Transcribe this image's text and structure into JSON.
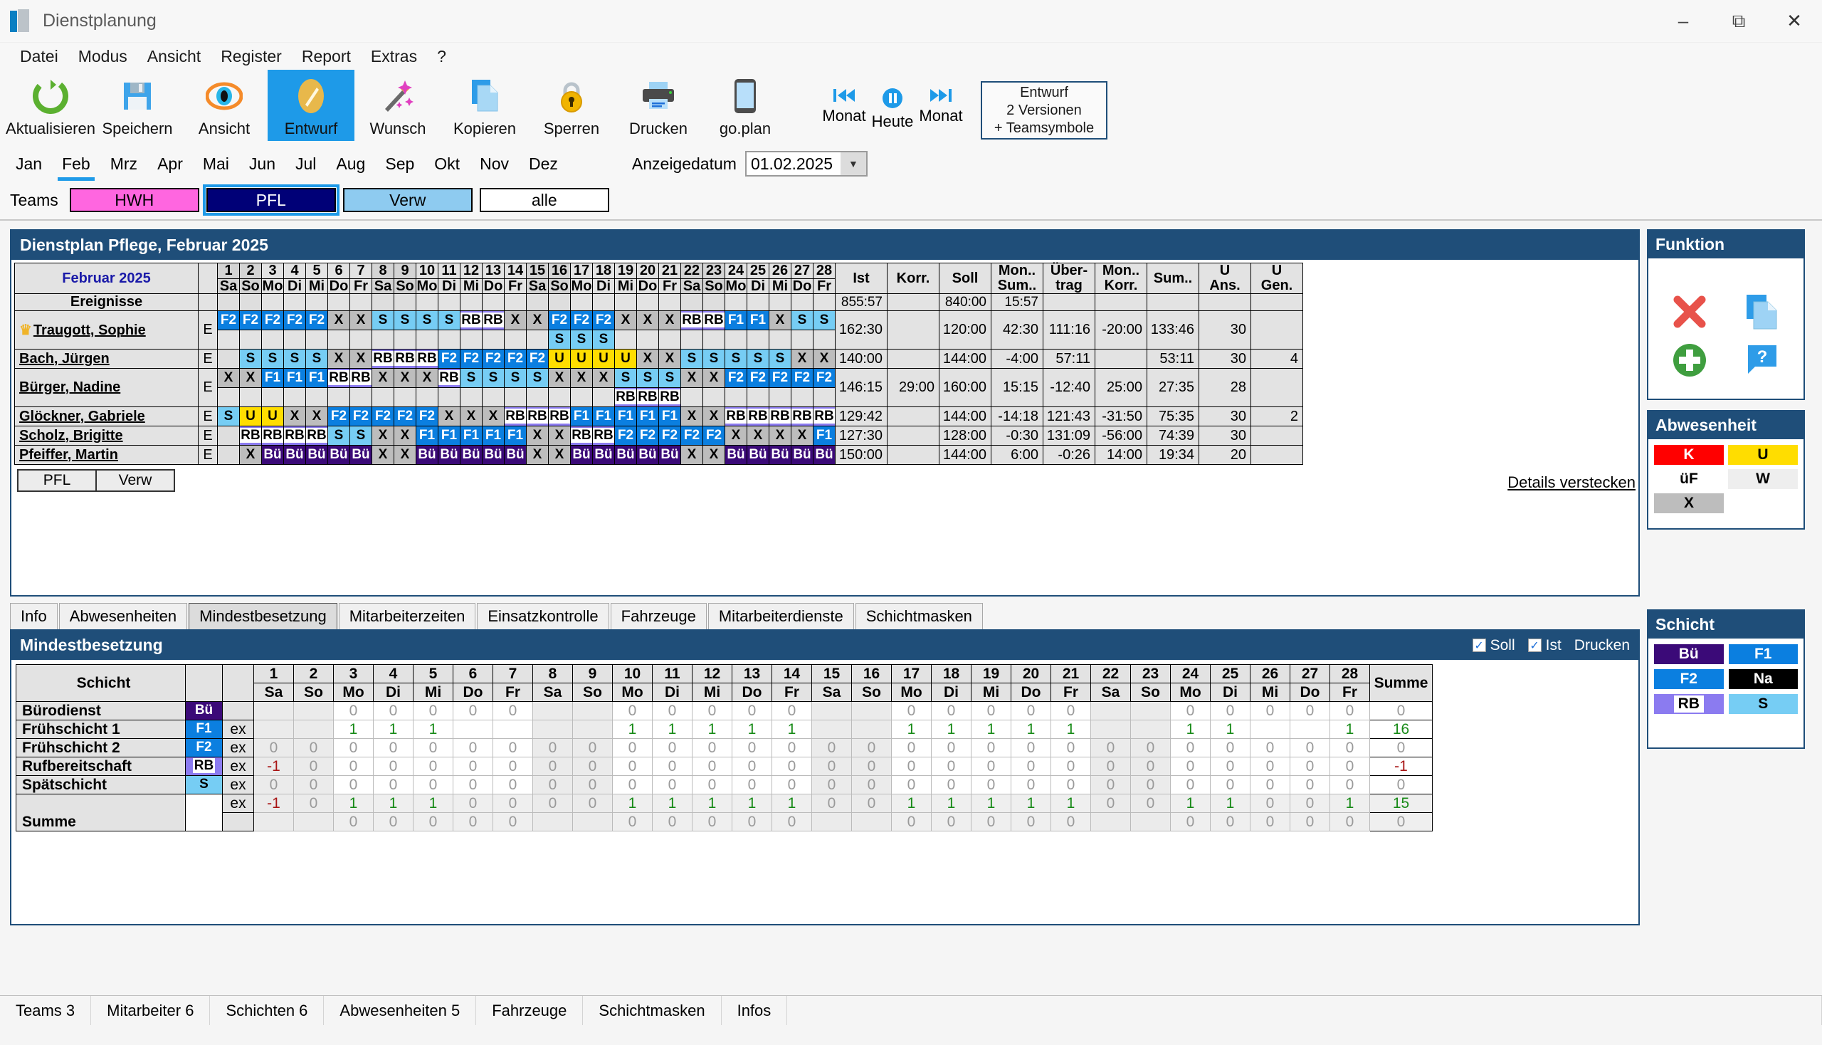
{
  "window": {
    "title": "Dienstplanung",
    "app_icon": "book-icon",
    "minimize": "minimize-icon",
    "restore": "restore-icon",
    "close": "close-icon"
  },
  "menu": {
    "items": [
      "Datei",
      "Modus",
      "Ansicht",
      "Register",
      "Report",
      "Extras",
      "?"
    ]
  },
  "toolbar": {
    "buttons": [
      {
        "label": "Aktualisieren",
        "icon": "refresh-icon",
        "selected": false
      },
      {
        "label": "Speichern",
        "icon": "floppy-disk-icon",
        "selected": false
      },
      {
        "label": "Ansicht",
        "icon": "eye-icon",
        "selected": false
      },
      {
        "label": "Entwurf",
        "icon": "pencil-icon",
        "selected": true
      },
      {
        "label": "Wunsch",
        "icon": "magic-wand-icon",
        "selected": false
      },
      {
        "label": "Kopieren",
        "icon": "copy-icon",
        "selected": false
      },
      {
        "label": "Sperren",
        "icon": "padlock-icon",
        "selected": false
      },
      {
        "label": "Drucken",
        "icon": "printer-icon",
        "selected": false
      },
      {
        "label": "go.plan",
        "icon": "smartphone-icon",
        "selected": false
      }
    ],
    "nav": [
      {
        "label": "Monat",
        "icon": "skip-back-icon"
      },
      {
        "label": "Heute",
        "icon": "pause-circle-icon"
      },
      {
        "label": "Monat",
        "icon": "skip-forward-icon"
      }
    ],
    "version_box": [
      "Entwurf",
      "2 Versionen",
      "+ Teamsymbole"
    ]
  },
  "months": {
    "items": [
      "Jan",
      "Feb",
      "Mrz",
      "Apr",
      "Mai",
      "Jun",
      "Jul",
      "Aug",
      "Sep",
      "Okt",
      "Nov",
      "Dez"
    ],
    "active": "Feb",
    "date_label": "Anzeigedatum",
    "date_value": "01.02.2025"
  },
  "teams": {
    "label": "Teams",
    "items": [
      {
        "name": "HWH",
        "bg": "#ff66e0",
        "fg": "#000000",
        "selected": false
      },
      {
        "name": "PFL",
        "bg": "#000077",
        "fg": "#ffffff",
        "selected": true
      },
      {
        "name": "Verw",
        "bg": "#8ecbf0",
        "fg": "#000000",
        "selected": false
      },
      {
        "name": "alle",
        "bg": "#ffffff",
        "fg": "#000000",
        "selected": false
      }
    ]
  },
  "schedule": {
    "title": "Dienstplan Pflege,  Februar 2025",
    "month_title": "Februar 2025",
    "events_label": "Ereignisse",
    "days": [
      {
        "n": "1",
        "w": "Sa",
        "we": true
      },
      {
        "n": "2",
        "w": "So",
        "we": true
      },
      {
        "n": "3",
        "w": "Mo",
        "we": false
      },
      {
        "n": "4",
        "w": "Di",
        "we": false
      },
      {
        "n": "5",
        "w": "Mi",
        "we": false
      },
      {
        "n": "6",
        "w": "Do",
        "we": false
      },
      {
        "n": "7",
        "w": "Fr",
        "we": false
      },
      {
        "n": "8",
        "w": "Sa",
        "we": true
      },
      {
        "n": "9",
        "w": "So",
        "we": true
      },
      {
        "n": "10",
        "w": "Mo",
        "we": false
      },
      {
        "n": "11",
        "w": "Di",
        "we": false
      },
      {
        "n": "12",
        "w": "Mi",
        "we": false
      },
      {
        "n": "13",
        "w": "Do",
        "we": false
      },
      {
        "n": "14",
        "w": "Fr",
        "we": false
      },
      {
        "n": "15",
        "w": "Sa",
        "we": true
      },
      {
        "n": "16",
        "w": "So",
        "we": true
      },
      {
        "n": "17",
        "w": "Mo",
        "we": false
      },
      {
        "n": "18",
        "w": "Di",
        "we": false
      },
      {
        "n": "19",
        "w": "Mi",
        "we": false
      },
      {
        "n": "20",
        "w": "Do",
        "we": false
      },
      {
        "n": "21",
        "w": "Fr",
        "we": false
      },
      {
        "n": "22",
        "w": "Sa",
        "we": true
      },
      {
        "n": "23",
        "w": "So",
        "we": true
      },
      {
        "n": "24",
        "w": "Mo",
        "we": false
      },
      {
        "n": "25",
        "w": "Di",
        "we": false
      },
      {
        "n": "26",
        "w": "Mi",
        "we": false
      },
      {
        "n": "27",
        "w": "Do",
        "we": false
      },
      {
        "n": "28",
        "w": "Fr",
        "we": false
      }
    ],
    "num_headers": [
      "Ist",
      "Korr.",
      "Soll",
      "Mon..\nSum..",
      "Über-\ntrag",
      "Mon..\nKorr.",
      "Sum..",
      "U\nAns.",
      "U\nGen."
    ],
    "totals_row": {
      "ist": "855:57",
      "korr": "",
      "soll": "840:00",
      "monsum": "15:57",
      "uebertrag": "",
      "monkorr": "",
      "sum": "",
      "uans": "",
      "ugen": ""
    },
    "employees": [
      {
        "name": "Traugott, Sophie",
        "crown": true,
        "E": "E",
        "shifts1": [
          "F2",
          "F2",
          "F2",
          "F2",
          "F2",
          "X",
          "X",
          "S",
          "S",
          "S",
          "S",
          "RB",
          "RB",
          "X",
          "X",
          "F2",
          "F2",
          "F2",
          "X",
          "X",
          "X",
          "RB",
          "RB",
          "F1",
          "F1",
          "X",
          "S",
          "S"
        ],
        "shifts2": [
          "",
          "",
          "",
          "",
          "",
          "",
          "",
          "",
          "",
          "",
          "",
          "",
          "",
          "",
          "",
          "S",
          "S",
          "S",
          "",
          "",
          "",
          "",
          "",
          "",
          "",
          "",
          "",
          ""
        ],
        "ist": "162:30",
        "korr": "",
        "soll": "120:00",
        "monsum": "42:30",
        "uebertrag": "111:16",
        "monkorr": "-20:00",
        "sum": "133:46",
        "uans": "30",
        "ugen": ""
      },
      {
        "name": "Bach, Jürgen",
        "crown": false,
        "E": "E",
        "shifts1": [
          "",
          "S",
          "S",
          "S",
          "S",
          "X",
          "X",
          "RB",
          "RB",
          "RB",
          "F2",
          "F2",
          "F2",
          "F2",
          "F2",
          "U",
          "U",
          "U",
          "U",
          "X",
          "X",
          "S",
          "S",
          "S",
          "S",
          "S",
          "X",
          "X"
        ],
        "shifts2": [],
        "ist": "140:00",
        "korr": "",
        "soll": "144:00",
        "monsum": "-4:00",
        "uebertrag": "57:11",
        "monkorr": "",
        "sum": "53:11",
        "uans": "30",
        "ugen": "4"
      },
      {
        "name": "Bürger, Nadine",
        "crown": false,
        "E": "E",
        "shifts1": [
          "X",
          "X",
          "F1",
          "F1",
          "F1",
          "RB",
          "RB",
          "X",
          "X",
          "X",
          "RB",
          "S",
          "S",
          "S",
          "S",
          "X",
          "X",
          "X",
          "S",
          "S",
          "S",
          "X",
          "X",
          "F2",
          "F2",
          "F2",
          "F2",
          "F2"
        ],
        "shifts2": [
          "",
          "",
          "",
          "",
          "",
          "",
          "",
          "",
          "",
          "",
          "",
          "",
          "",
          "",
          "",
          "",
          "",
          "",
          "RB",
          "RB",
          "RB",
          "",
          "",
          "",
          "",
          "",
          "",
          ""
        ],
        "ist": "146:15",
        "korr": "29:00",
        "soll": "160:00",
        "monsum": "15:15",
        "uebertrag": "-12:40",
        "monkorr": "25:00",
        "sum": "27:35",
        "uans": "28",
        "ugen": ""
      },
      {
        "name": "Glöckner, Gabriele",
        "crown": false,
        "E": "E",
        "shifts1": [
          "S",
          "U",
          "U",
          "X",
          "X",
          "F2",
          "F2",
          "F2",
          "F2",
          "F2",
          "X",
          "X",
          "X",
          "RB",
          "RB",
          "RB",
          "F1",
          "F1",
          "F1",
          "F1",
          "F1",
          "X",
          "X",
          "RB",
          "RB",
          "RB",
          "RB",
          "RB"
        ],
        "shifts2": [],
        "ist": "129:42",
        "korr": "",
        "soll": "144:00",
        "monsum": "-14:18",
        "uebertrag": "121:43",
        "monkorr": "-31:50",
        "sum": "75:35",
        "uans": "30",
        "ugen": "2"
      },
      {
        "name": "Scholz, Brigitte",
        "crown": false,
        "E": "E",
        "shifts1": [
          "",
          "RB",
          "RB",
          "RB",
          "RB",
          "S",
          "S",
          "X",
          "X",
          "F1",
          "F1",
          "F1",
          "F1",
          "F1",
          "X",
          "X",
          "RB",
          "RB",
          "F2",
          "F2",
          "F2",
          "F2",
          "F2",
          "X",
          "X",
          "X",
          "X",
          "F1"
        ],
        "shifts2": [],
        "ist": "127:30",
        "korr": "",
        "soll": "128:00",
        "monsum": "-0:30",
        "uebertrag": "131:09",
        "monkorr": "-56:00",
        "sum": "74:39",
        "uans": "30",
        "ugen": ""
      },
      {
        "name": "Pfeiffer, Martin",
        "crown": false,
        "E": "E",
        "shifts1": [
          "",
          "X",
          "Bü",
          "Bü",
          "Bü",
          "Bü",
          "Bü",
          "X",
          "X",
          "Bü",
          "Bü",
          "Bü",
          "Bü",
          "Bü",
          "X",
          "X",
          "Bü",
          "Bü",
          "Bü",
          "Bü",
          "Bü",
          "X",
          "X",
          "Bü",
          "Bü",
          "Bü",
          "Bü",
          "Bü"
        ],
        "shifts2": [],
        "ist": "150:00",
        "korr": "",
        "soll": "144:00",
        "monsum": "6:00",
        "uebertrag": "-0:26",
        "monkorr": "14:00",
        "sum": "19:34",
        "uans": "20",
        "ugen": ""
      }
    ],
    "footer_team_buttons": [
      "PFL",
      "Verw"
    ],
    "details_link": "Details verstecken"
  },
  "tabs": {
    "items": [
      "Info",
      "Abwesenheiten",
      "Mindestbesetzung",
      "Mitarbeiterzeiten",
      "Einsatzkontrolle",
      "Fahrzeuge",
      "Mitarbeiterdienste",
      "Schichtmasken"
    ],
    "active": "Mindestbesetzung"
  },
  "mindestbesetzung": {
    "title": "Mindestbesetzung",
    "soll_label": "Soll",
    "ist_label": "Ist",
    "drucken_label": "Drucken",
    "col_schicht": "Schicht",
    "col_summe": "Summe",
    "days": [
      {
        "n": "1",
        "w": "Sa",
        "we": true
      },
      {
        "n": "2",
        "w": "So",
        "we": true
      },
      {
        "n": "3",
        "w": "Mo",
        "we": false
      },
      {
        "n": "4",
        "w": "Di",
        "we": false
      },
      {
        "n": "5",
        "w": "Mi",
        "we": false
      },
      {
        "n": "6",
        "w": "Do",
        "we": false
      },
      {
        "n": "7",
        "w": "Fr",
        "we": false
      },
      {
        "n": "8",
        "w": "Sa",
        "we": true
      },
      {
        "n": "9",
        "w": "So",
        "we": true
      },
      {
        "n": "10",
        "w": "Mo",
        "we": false
      },
      {
        "n": "11",
        "w": "Di",
        "we": false
      },
      {
        "n": "12",
        "w": "Mi",
        "we": false
      },
      {
        "n": "13",
        "w": "Do",
        "we": false
      },
      {
        "n": "14",
        "w": "Fr",
        "we": false
      },
      {
        "n": "15",
        "w": "Sa",
        "we": true
      },
      {
        "n": "16",
        "w": "So",
        "we": true
      },
      {
        "n": "17",
        "w": "Mo",
        "we": false
      },
      {
        "n": "18",
        "w": "Di",
        "we": false
      },
      {
        "n": "19",
        "w": "Mi",
        "we": false
      },
      {
        "n": "20",
        "w": "Do",
        "we": false
      },
      {
        "n": "21",
        "w": "Fr",
        "we": false
      },
      {
        "n": "22",
        "w": "Sa",
        "we": true
      },
      {
        "n": "23",
        "w": "So",
        "we": true
      },
      {
        "n": "24",
        "w": "Mo",
        "we": false
      },
      {
        "n": "25",
        "w": "Di",
        "we": false
      },
      {
        "n": "26",
        "w": "Mi",
        "we": false
      },
      {
        "n": "27",
        "w": "Do",
        "we": false
      },
      {
        "n": "28",
        "w": "Fr",
        "we": false
      }
    ],
    "rows": [
      {
        "name": "Bürodienst",
        "code": "Bü",
        "code_style": "s-Bu",
        "ex": "",
        "values": [
          "",
          "",
          "0",
          "0",
          "0",
          "0",
          "0",
          "",
          "",
          "0",
          "0",
          "0",
          "0",
          "0",
          "",
          "",
          "0",
          "0",
          "0",
          "0",
          "0",
          "",
          "",
          "0",
          "0",
          "0",
          "0",
          "0"
        ],
        "summe": "0"
      },
      {
        "name": "Frühschicht 1",
        "code": "F1",
        "code_style": "s-F1",
        "ex": "ex",
        "values": [
          "",
          "",
          "1",
          "1",
          "1",
          "",
          "",
          "",
          "",
          "1",
          "1",
          "1",
          "1",
          "1",
          "",
          "",
          "1",
          "1",
          "1",
          "1",
          "1",
          "",
          "",
          "1",
          "1",
          "",
          "",
          "1"
        ],
        "summe": "16"
      },
      {
        "name": "Frühschicht 2",
        "code": "F2",
        "code_style": "s-F2",
        "ex": "ex",
        "values": [
          "0",
          "0",
          "0",
          "0",
          "0",
          "0",
          "0",
          "0",
          "0",
          "0",
          "0",
          "0",
          "0",
          "0",
          "0",
          "0",
          "0",
          "0",
          "0",
          "0",
          "0",
          "0",
          "0",
          "0",
          "0",
          "0",
          "0",
          "0"
        ],
        "summe": "0"
      },
      {
        "name": "Rufbereitschaft",
        "code": "RB",
        "code_style": "s-RB",
        "ex": "ex",
        "values": [
          "-1",
          "0",
          "0",
          "0",
          "0",
          "0",
          "0",
          "0",
          "0",
          "0",
          "0",
          "0",
          "0",
          "0",
          "0",
          "0",
          "0",
          "0",
          "0",
          "0",
          "0",
          "0",
          "0",
          "0",
          "0",
          "0",
          "0",
          "0"
        ],
        "summe": "-1"
      },
      {
        "name": "Spätschicht",
        "code": "S",
        "code_style": "s-S",
        "ex": "ex",
        "values": [
          "0",
          "0",
          "0",
          "0",
          "0",
          "0",
          "0",
          "0",
          "0",
          "0",
          "0",
          "0",
          "0",
          "0",
          "0",
          "0",
          "0",
          "0",
          "0",
          "0",
          "0",
          "0",
          "0",
          "0",
          "0",
          "0",
          "0",
          "0"
        ],
        "summe": "0"
      }
    ],
    "summe_row_a": {
      "label": "Summe",
      "ex": "ex",
      "values": [
        "-1",
        "0",
        "1",
        "1",
        "1",
        "0",
        "0",
        "0",
        "0",
        "1",
        "1",
        "1",
        "1",
        "1",
        "0",
        "0",
        "1",
        "1",
        "1",
        "1",
        "1",
        "0",
        "0",
        "1",
        "1",
        "0",
        "0",
        "1"
      ],
      "summe": "15"
    },
    "summe_row_b": {
      "label": "",
      "ex": "",
      "values": [
        "",
        "",
        "0",
        "0",
        "0",
        "0",
        "0",
        "",
        "",
        "0",
        "0",
        "0",
        "0",
        "0",
        "",
        "",
        "0",
        "0",
        "0",
        "0",
        "0",
        "",
        "",
        "0",
        "0",
        "0",
        "0",
        "0"
      ],
      "summe": "0"
    }
  },
  "sidebar": {
    "funktion": {
      "title": "Funktion",
      "icons": [
        "red-x-icon",
        "copy-pages-icon",
        "green-plus-icon",
        "help-bubble-icon"
      ]
    },
    "abwesenheit": {
      "title": "Abwesenheit",
      "chips": [
        {
          "code": "K",
          "bg": "#ff0000",
          "fg": "#ffffff"
        },
        {
          "code": "U",
          "bg": "#ffdd00",
          "fg": "#000000"
        },
        {
          "code": "üF",
          "bg": "#ffffff",
          "fg": "#000000"
        },
        {
          "code": "W",
          "bg": "#eeeeee",
          "fg": "#000000"
        },
        {
          "code": "X",
          "bg": "#bdbdbd",
          "fg": "#000000"
        }
      ]
    },
    "schicht": {
      "title": "Schicht",
      "chips": [
        {
          "code": "Bü",
          "bg": "#3b0a78",
          "fg": "#ffffff"
        },
        {
          "code": "F1",
          "bg": "#0b7fe0",
          "fg": "#ffffff"
        },
        {
          "code": "F2",
          "bg": "#0b7fe0",
          "fg": "#ffffff"
        },
        {
          "code": "Na",
          "bg": "#000000",
          "fg": "#ffffff"
        },
        {
          "code": "RB",
          "bg": "#8b7bf0",
          "fg": "#000000"
        },
        {
          "code": "S",
          "bg": "#76cdf4",
          "fg": "#000000"
        }
      ]
    }
  },
  "statusbar": {
    "items": [
      "Teams 3",
      "Mitarbeiter 6",
      "Schichten 6",
      "Abwesenheiten 5",
      "Fahrzeuge",
      "Schichtmasken",
      "Infos",
      ""
    ]
  }
}
